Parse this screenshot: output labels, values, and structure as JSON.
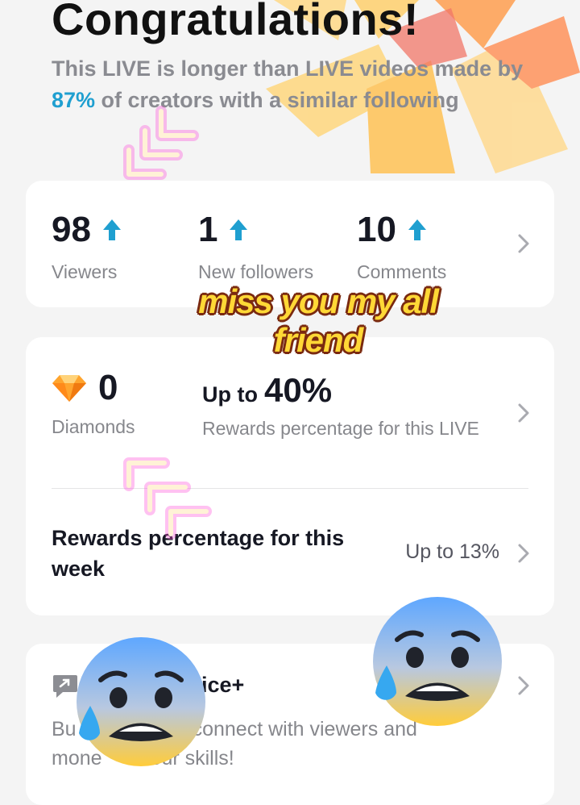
{
  "header": {
    "title": "Congratulations!",
    "subtitle_pre": "This LIVE is longer than LIVE videos made by ",
    "subtitle_pct": "87%",
    "subtitle_post": " of creators with a similar following"
  },
  "stats": [
    {
      "value": "98",
      "label": "Viewers"
    },
    {
      "value": "1",
      "label": "New followers"
    },
    {
      "value": "10",
      "label": "Comments"
    }
  ],
  "rewards": {
    "diamonds_value": "0",
    "diamonds_label": "Diamonds",
    "upto_prefix": "Up to",
    "upto_value": "40%",
    "upto_label": "Rewards percentage for this LIVE",
    "week_label": "Rewards percentage for this week",
    "week_value": "Up to 13%"
  },
  "service": {
    "title_fragment": "ice+",
    "desc_fragment_1": "Bu",
    "desc_fragment_2": "connect with viewers and",
    "desc_fragment_3": "mone",
    "desc_fragment_4": "our skills!"
  },
  "overlay": {
    "caption": "miss you my all friend"
  },
  "colors": {
    "accent_blue": "#1f9fd0",
    "background": "#f4f4f4",
    "card": "#ffffff",
    "caption_fill": "#ffd836",
    "caption_outline": "#7a2a10"
  },
  "icons": {
    "stat_arrow": "arrow-up-icon",
    "row_arrow": "chevron-right-icon",
    "diamond": "diamond-icon",
    "service": "chat-bubble-icon",
    "sticker": "neon-chevron-sticker",
    "emoji": "anxious-face-with-sweat-emoji"
  }
}
